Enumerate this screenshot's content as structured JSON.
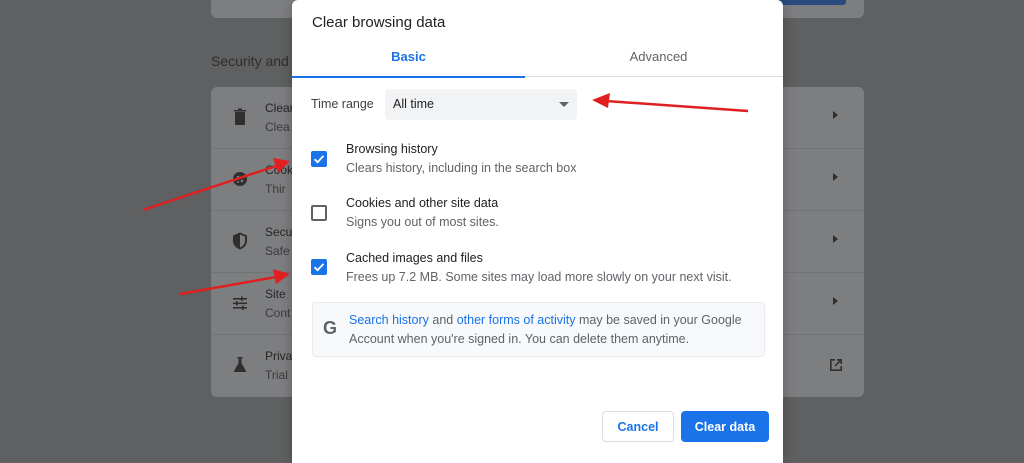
{
  "settings_page": {
    "section_title": "Security and",
    "rows": [
      {
        "title": "Clear",
        "subtitle": "Clea",
        "icon": "trash-icon"
      },
      {
        "title": "Cook",
        "subtitle": "Thir",
        "icon": "cookie-icon"
      },
      {
        "title": "Secu",
        "subtitle": "Safe",
        "icon": "shield-icon"
      },
      {
        "title": "Site",
        "subtitle": "Cont",
        "icon": "sliders-icon"
      },
      {
        "title": "Priva",
        "subtitle": "Trial",
        "icon": "flask-icon"
      }
    ]
  },
  "dialog": {
    "title": "Clear browsing data",
    "tabs": [
      {
        "label": "Basic",
        "active": true
      },
      {
        "label": "Advanced",
        "active": false
      }
    ],
    "time_range": {
      "label": "Time range",
      "value": "All time"
    },
    "options": [
      {
        "title": "Browsing history",
        "description": "Clears history, including in the search box",
        "checked": true
      },
      {
        "title": "Cookies and other site data",
        "description": "Signs you out of most sites.",
        "checked": false
      },
      {
        "title": "Cached images and files",
        "description": "Frees up 7.2 MB. Some sites may load more slowly on your next visit.",
        "checked": true
      }
    ],
    "google_notice": {
      "link1": "Search history",
      "text1": " and ",
      "link2": "other forms of activity",
      "text2": " may be saved in your Google",
      "line2": "Account when you're signed in. You can delete them anytime.",
      "icon": "google-g-icon"
    },
    "buttons": {
      "cancel": "Cancel",
      "clear": "Clear data"
    }
  },
  "colors": {
    "accent": "#1a73e8",
    "annotation_arrow": "#e02020",
    "overlay": "#5f6061"
  }
}
